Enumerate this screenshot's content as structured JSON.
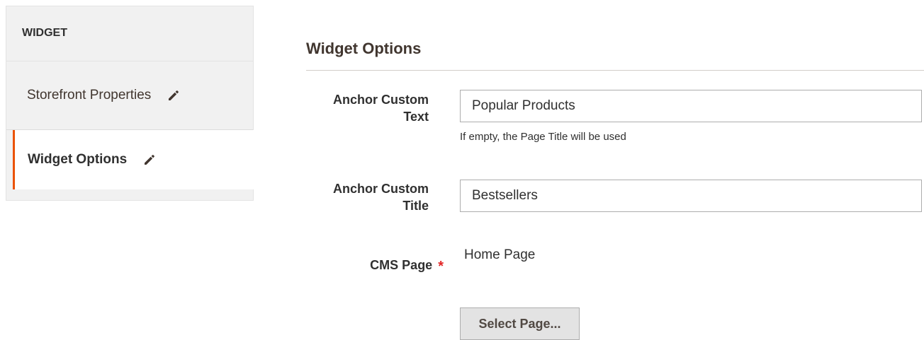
{
  "sidebar": {
    "header": "WIDGET",
    "tabs": [
      {
        "label": "Storefront Properties",
        "icon": "pencil-icon",
        "active": false
      },
      {
        "label": "Widget Options",
        "icon": "pencil-icon",
        "active": true
      }
    ]
  },
  "section": {
    "title": "Widget Options"
  },
  "fields": {
    "anchor_text": {
      "label_line1": "Anchor Custom",
      "label_line2": "Text",
      "value": "Popular Products",
      "note": "If empty, the Page Title will be used"
    },
    "anchor_title": {
      "label_line1": "Anchor Custom",
      "label_line2": "Title",
      "value": "Bestsellers"
    },
    "cms_page": {
      "label": "CMS Page",
      "required_mark": "*",
      "value": "Home Page",
      "button_label": "Select Page..."
    }
  },
  "colors": {
    "accent": "#eb5202",
    "required": "#e22626",
    "sidebar_bg": "#f1f1f1"
  }
}
